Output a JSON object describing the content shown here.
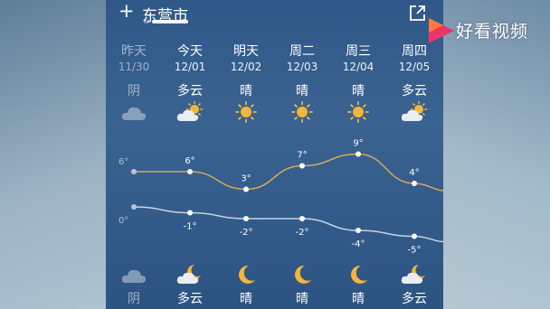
{
  "header": {
    "add_label": "+",
    "city": "东营市"
  },
  "watermark": {
    "text": "好看视频",
    "icon": "play-triangle-logo"
  },
  "days": [
    {
      "day": "昨天",
      "date": "11/30",
      "day_cond": "阴",
      "day_icon": "cloud",
      "night_icon": "cloud",
      "night_cond": "阴",
      "high": "6°",
      "low": "0°",
      "past": true
    },
    {
      "day": "今天",
      "date": "12/01",
      "day_cond": "多云",
      "day_icon": "partly-cloudy-sun",
      "night_icon": "partly-cloudy-moon",
      "night_cond": "多云",
      "high": "6°",
      "low": "-1°",
      "past": false
    },
    {
      "day": "明天",
      "date": "12/02",
      "day_cond": "晴",
      "day_icon": "sun",
      "night_icon": "moon",
      "night_cond": "晴",
      "high": "3°",
      "low": "-2°",
      "past": false
    },
    {
      "day": "周二",
      "date": "12/03",
      "day_cond": "晴",
      "day_icon": "sun",
      "night_icon": "moon",
      "night_cond": "晴",
      "high": "7°",
      "low": "-2°",
      "past": false
    },
    {
      "day": "周三",
      "date": "12/04",
      "day_cond": "晴",
      "day_icon": "sun",
      "night_icon": "moon",
      "night_cond": "晴",
      "high": "9°",
      "low": "-4°",
      "past": false
    },
    {
      "day": "周四",
      "date": "12/05",
      "day_cond": "多云",
      "day_icon": "partly-cloudy-sun",
      "night_icon": "partly-cloudy-moon",
      "night_cond": "多云",
      "high": "4°",
      "low": "-5°",
      "past": false
    }
  ],
  "chart_data": {
    "type": "line",
    "categories": [
      "11/30",
      "12/01",
      "12/02",
      "12/03",
      "12/04",
      "12/05"
    ],
    "series": [
      {
        "values": [
          6,
          6,
          3,
          7,
          9,
          4
        ],
        "color": "#d9a65a"
      },
      {
        "values": [
          0,
          -1,
          -2,
          -2,
          -4,
          -5
        ],
        "color": "#c5d3e3"
      }
    ],
    "ylim": [
      -6,
      10
    ]
  },
  "colors": {
    "sun": "#f5b63a",
    "moon": "#f3b53b",
    "cloud": "#c9d3de"
  }
}
